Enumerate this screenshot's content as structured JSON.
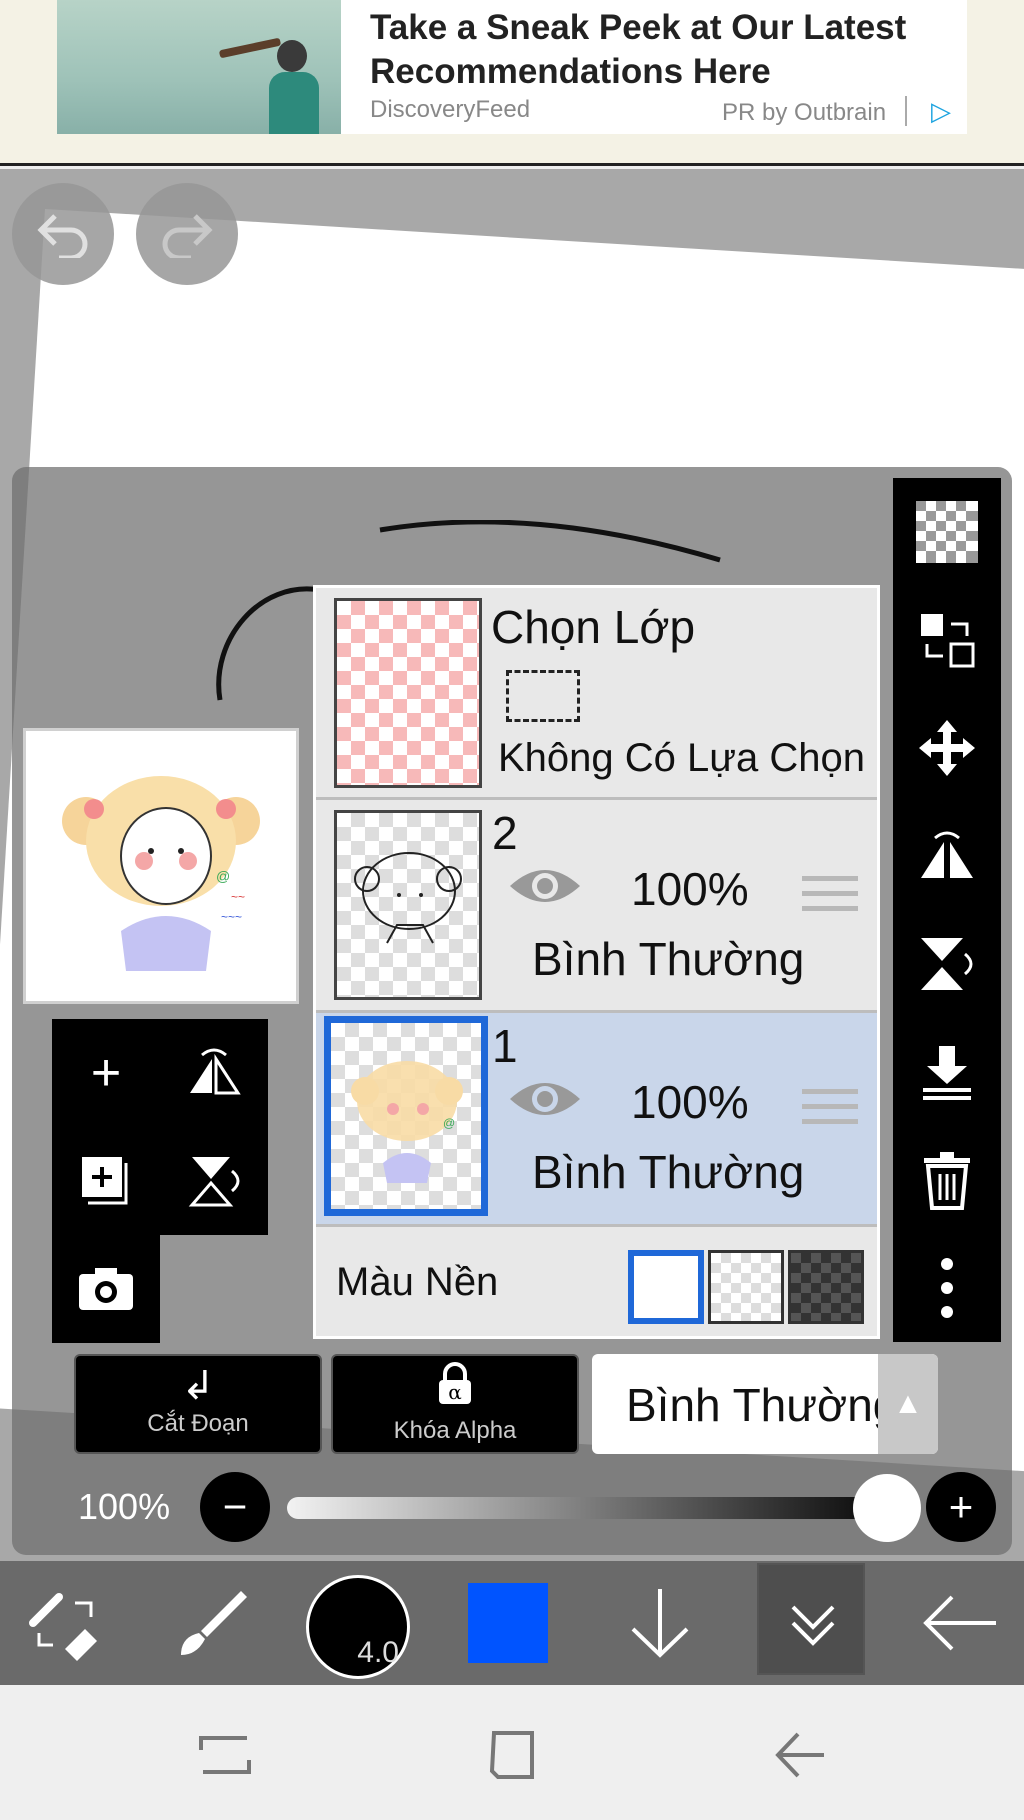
{
  "ad": {
    "title": "Take a Sneak Peek at Our Latest Recommendations Here",
    "source": "DiscoveryFeed",
    "sponsor": "PR by Outbrain"
  },
  "layers_panel": {
    "selection_layer": {
      "title": "Chọn Lớp",
      "subtitle": "Không Có Lựa Chọn"
    },
    "layers": [
      {
        "name": "2",
        "opacity": "100%",
        "blend": "Bình Thường",
        "active": false
      },
      {
        "name": "1",
        "opacity": "100%",
        "blend": "Bình Thường",
        "active": true
      }
    ],
    "background": {
      "label": "Màu Nền",
      "options": [
        "white",
        "transparent",
        "dark"
      ],
      "selected": "white"
    }
  },
  "controls": {
    "clip_label": "Cắt Đoạn",
    "alpha_lock_label": "Khóa Alpha",
    "alpha_symbol": "α",
    "blend_mode": "Bình Thường",
    "opacity_label": "100%",
    "opacity_value": 1.0
  },
  "toolbar": {
    "brush_size": "4.0",
    "current_color": "#0054ff"
  },
  "colors": {
    "accent": "#1f68d8",
    "active_row": "#c9d6ea"
  }
}
